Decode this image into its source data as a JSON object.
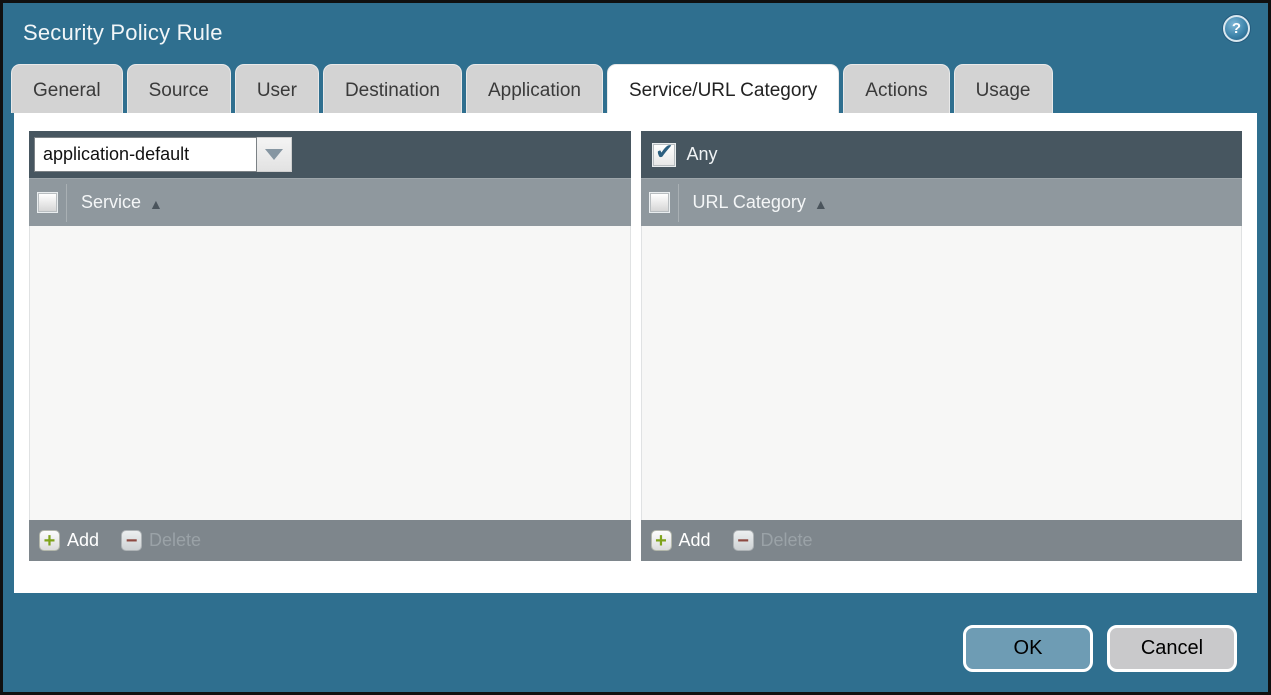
{
  "window": {
    "title": "Security Policy Rule"
  },
  "help_icon": {
    "glyph": "?"
  },
  "tabs": [
    {
      "label": "General",
      "active": false
    },
    {
      "label": "Source",
      "active": false
    },
    {
      "label": "User",
      "active": false
    },
    {
      "label": "Destination",
      "active": false
    },
    {
      "label": "Application",
      "active": false
    },
    {
      "label": "Service/URL Category",
      "active": true
    },
    {
      "label": "Actions",
      "active": false
    },
    {
      "label": "Usage",
      "active": false
    }
  ],
  "service_panel": {
    "dropdown_value": "application-default",
    "column_header": "Service",
    "sort_order": "ascending",
    "sort_glyph": "▲",
    "add_label": "Add",
    "delete_label": "Delete",
    "delete_enabled": false,
    "rows": []
  },
  "url_category_panel": {
    "any_label": "Any",
    "any_checked": true,
    "column_header": "URL Category",
    "sort_order": "ascending",
    "sort_glyph": "▲",
    "add_label": "Add",
    "delete_label": "Delete",
    "delete_enabled": false,
    "rows": []
  },
  "dialog_buttons": {
    "ok": "OK",
    "cancel": "Cancel"
  },
  "colors": {
    "background_teal": "#2f6f8f",
    "toolbar_dark": "#475660",
    "column_header_gray": "#8f989e",
    "footer_gray": "#7e868c",
    "panel_body": "#f7f7f6",
    "tab_gray": "#d3d3d3",
    "active_tab": "#ffffff",
    "ok_button": "#6e9cb4",
    "cancel_button": "#c9c9cb",
    "add_icon_green": "#7fa31b",
    "delete_icon_red": "#8d4a42",
    "check_blue": "#2c5f80"
  }
}
